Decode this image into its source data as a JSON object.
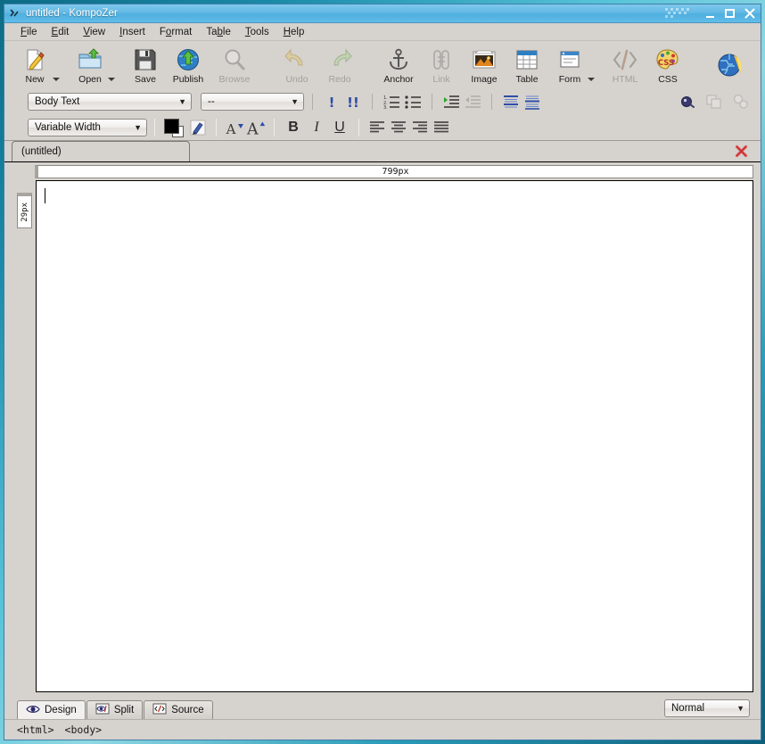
{
  "window": {
    "title": "untitled - KompoZer",
    "app_icon": "kompozer-icon",
    "controls": {
      "minimize": "–",
      "maximize": "□",
      "close": "✕"
    }
  },
  "menubar": {
    "items": [
      {
        "label": "File",
        "accel": "F"
      },
      {
        "label": "Edit",
        "accel": "E"
      },
      {
        "label": "View",
        "accel": "V"
      },
      {
        "label": "Insert",
        "accel": "I"
      },
      {
        "label": "Format",
        "accel": "o"
      },
      {
        "label": "Table",
        "accel": "b"
      },
      {
        "label": "Tools",
        "accel": "T"
      },
      {
        "label": "Help",
        "accel": "H"
      }
    ]
  },
  "toolbar_main": {
    "buttons": [
      {
        "label": "New",
        "icon": "new-page-icon",
        "enabled": true,
        "dropdown": true
      },
      {
        "label": "Open",
        "icon": "open-folder-icon",
        "enabled": true,
        "dropdown": true
      },
      {
        "label": "Save",
        "icon": "save-floppy-icon",
        "enabled": true,
        "dropdown": false
      },
      {
        "label": "Publish",
        "icon": "publish-globe-icon",
        "enabled": true,
        "dropdown": false
      },
      {
        "label": "Browse",
        "icon": "browse-magnifier-icon",
        "enabled": false,
        "dropdown": false
      },
      {
        "label": "Undo",
        "icon": "undo-arrow-icon",
        "enabled": false,
        "dropdown": false
      },
      {
        "label": "Redo",
        "icon": "redo-arrow-icon",
        "enabled": false,
        "dropdown": false
      },
      {
        "label": "Anchor",
        "icon": "anchor-icon",
        "enabled": true,
        "dropdown": false
      },
      {
        "label": "Link",
        "icon": "link-chain-icon",
        "enabled": false,
        "dropdown": false
      },
      {
        "label": "Image",
        "icon": "image-photo-icon",
        "enabled": true,
        "dropdown": false
      },
      {
        "label": "Table",
        "icon": "table-grid-icon",
        "enabled": true,
        "dropdown": false
      },
      {
        "label": "Form",
        "icon": "form-window-icon",
        "enabled": true,
        "dropdown": true
      },
      {
        "label": "HTML",
        "icon": "html-code-icon",
        "enabled": false,
        "dropdown": false
      },
      {
        "label": "CSS",
        "icon": "css-palette-icon",
        "enabled": true,
        "dropdown": false
      }
    ],
    "browser_icon": "browser-globe-icon"
  },
  "toolbar_format_row1": {
    "paragraph_style": {
      "value": "Body Text",
      "icon": "chevron-down-icon"
    },
    "class_style": {
      "value": "--",
      "icon": "chevron-down-icon"
    },
    "buttons": [
      {
        "name": "emphasis-button",
        "icon": "emphasis-icon",
        "enabled": true
      },
      {
        "name": "strong-button",
        "icon": "strong-icon",
        "enabled": true
      },
      {
        "name": "numbered-list-button",
        "icon": "numbered-list-icon",
        "enabled": true
      },
      {
        "name": "bulleted-list-button",
        "icon": "bulleted-list-icon",
        "enabled": true
      },
      {
        "name": "indent-button",
        "icon": "indent-icon",
        "enabled": true
      },
      {
        "name": "outdent-button",
        "icon": "outdent-icon",
        "enabled": false
      },
      {
        "name": "definition-term-button",
        "icon": "definition-term-icon",
        "enabled": true
      },
      {
        "name": "definition-desc-button",
        "icon": "definition-description-icon",
        "enabled": true
      }
    ],
    "right_buttons": [
      {
        "name": "css-editor-button",
        "icon": "css-circle-icon",
        "enabled": true
      },
      {
        "name": "group-shapes-button",
        "icon": "shapes-overlap-icon",
        "enabled": false
      },
      {
        "name": "ungroup-shapes-button",
        "icon": "shapes-split-icon",
        "enabled": false
      }
    ]
  },
  "toolbar_format_row2": {
    "font_family": {
      "value": "Variable Width",
      "icon": "chevron-down-icon"
    },
    "foreground_color": "#000000",
    "background_color": "#ffffff",
    "highlighter_icon": "highlighter-pen-icon",
    "smaller_font": {
      "label": "A",
      "icon": "font-smaller-icon"
    },
    "larger_font": {
      "label": "A",
      "icon": "font-larger-icon"
    },
    "bold": {
      "label": "B",
      "name": "bold-button"
    },
    "italic": {
      "label": "I",
      "name": "italic-button"
    },
    "underline": {
      "label": "U",
      "name": "underline-button"
    },
    "align_buttons": [
      {
        "name": "align-left-button",
        "icon": "align-left-icon"
      },
      {
        "name": "align-center-button",
        "icon": "align-center-icon"
      },
      {
        "name": "align-right-button",
        "icon": "align-right-icon"
      },
      {
        "name": "align-justify-button",
        "icon": "align-justify-icon"
      }
    ]
  },
  "document_tab": {
    "label": "(untitled)",
    "close_icon": "close-tab-icon"
  },
  "rulers": {
    "horizontal_value": "799px",
    "vertical_value": "29px"
  },
  "editor": {
    "content": "",
    "caret_visible": true
  },
  "mode_tabs": [
    {
      "label": "Design",
      "icon": "eye-icon",
      "active": true
    },
    {
      "label": "Split",
      "icon": "split-view-icon",
      "active": false
    },
    {
      "label": "Source",
      "icon": "source-code-icon",
      "active": false
    }
  ],
  "view_mode": {
    "value": "Normal",
    "icon": "chevron-down-icon"
  },
  "statusbar": {
    "breadcrumb": [
      "<html>",
      "<body>"
    ]
  }
}
